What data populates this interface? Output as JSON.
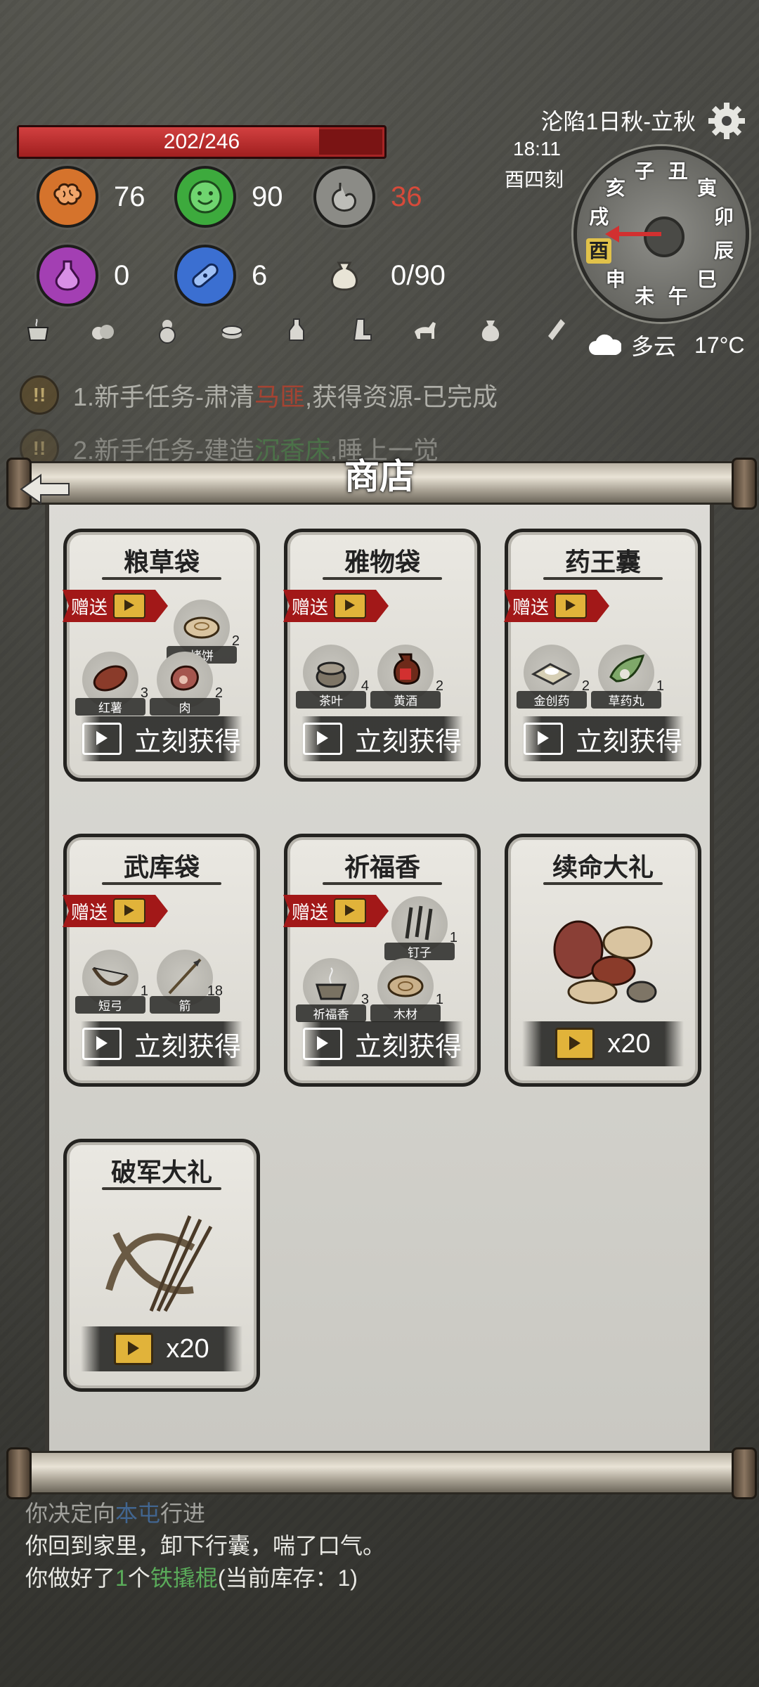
{
  "hud": {
    "hp_text": "202/246",
    "hp_fraction": 0.821,
    "stats": [
      {
        "name": "brain",
        "value": "76"
      },
      {
        "name": "mood",
        "value": "90"
      },
      {
        "name": "stomach",
        "value": "36"
      },
      {
        "name": "potion",
        "value": "0"
      },
      {
        "name": "bandage",
        "value": "6"
      },
      {
        "name": "bag",
        "value": "0/90"
      }
    ],
    "item_icons": [
      "pot-icon",
      "herbs-icon",
      "gourd-icon",
      "coins-icon",
      "bottle-icon",
      "boot-icon",
      "horse-icon",
      "pouch-icon",
      "brush-icon"
    ]
  },
  "clock": {
    "date": "沦陷1日秋-立秋",
    "time": "18:11",
    "ke": "酉四刻",
    "hours": [
      "子",
      "丑",
      "寅",
      "卯",
      "辰",
      "巳",
      "午",
      "未",
      "申",
      "酉",
      "戌",
      "亥"
    ],
    "weather": "多云",
    "temp": "17°C"
  },
  "quests": [
    {
      "pre": "1.新手任务-肃清",
      "hl": "马匪",
      "post": ",获得资源-已完成"
    },
    {
      "pre": "2.新手任务-建造",
      "hl": "沉香床",
      "post": ",睡上一觉"
    }
  ],
  "shop": {
    "title": "商店",
    "gift_label": "赠送",
    "buy_label": "立刻获得",
    "cards": [
      {
        "name": "粮草袋",
        "items": [
          {
            "lbl": "烤饼",
            "cnt": "2"
          },
          {
            "lbl": "红薯",
            "cnt": "3"
          },
          {
            "lbl": "肉",
            "cnt": "2"
          }
        ]
      },
      {
        "name": "雅物袋",
        "items": [
          {
            "lbl": "茶叶",
            "cnt": "4"
          },
          {
            "lbl": "黄酒",
            "cnt": "2"
          }
        ]
      },
      {
        "name": "药王囊",
        "items": [
          {
            "lbl": "金创药",
            "cnt": "2"
          },
          {
            "lbl": "草药丸",
            "cnt": "1"
          }
        ]
      },
      {
        "name": "武库袋",
        "items": [
          {
            "lbl": "短弓",
            "cnt": "1"
          },
          {
            "lbl": "箭",
            "cnt": "18"
          }
        ]
      },
      {
        "name": "祈福香",
        "items": [
          {
            "lbl": "钉子",
            "cnt": "1"
          },
          {
            "lbl": "祈福香",
            "cnt": "3"
          },
          {
            "lbl": "木材",
            "cnt": "1"
          }
        ]
      },
      {
        "name": "续命大礼",
        "price": "x20"
      },
      {
        "name": "破军大礼",
        "price": "x20"
      }
    ]
  },
  "log": {
    "line1_pre": "你决定向",
    "line1_hl": "本屯",
    "line1_post": "行进",
    "line2": "你回到家里，卸下行囊，喘了口气。",
    "line3_pre": "你做好了",
    "line3_num": "1",
    "line3_mid": "个",
    "line3_hl": "铁撬棍",
    "line3_post": "(当前库存：1)"
  }
}
